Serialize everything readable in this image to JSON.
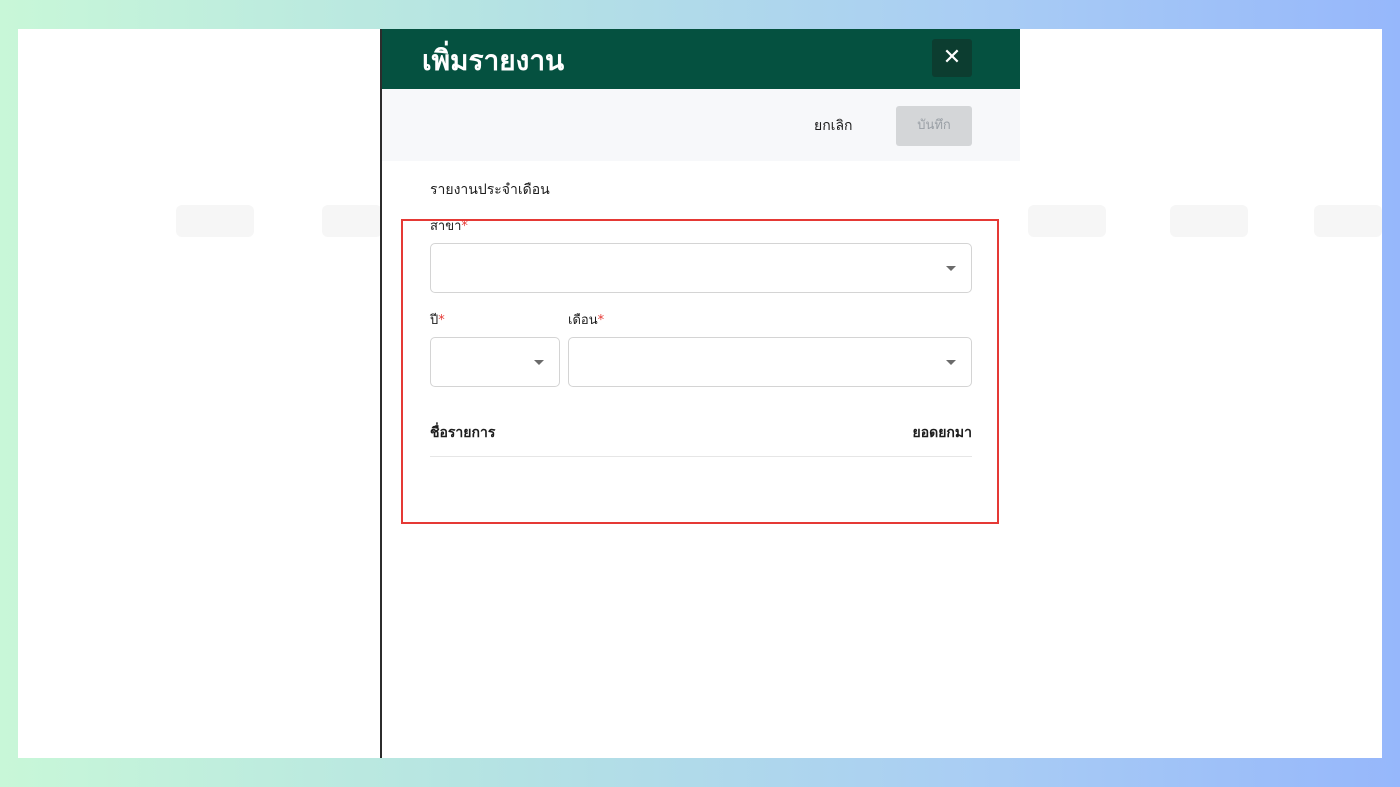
{
  "dialog": {
    "title": "เพิ่มรายงาน",
    "close_icon": "close-icon"
  },
  "actions": {
    "cancel_label": "ยกเลิก",
    "save_label": "บันทึก"
  },
  "form": {
    "section_title": "รายงานประจำเดือน",
    "branch": {
      "label": "สาขา",
      "required_mark": "*",
      "value": ""
    },
    "year": {
      "label": "ปี",
      "required_mark": "*",
      "value": ""
    },
    "month": {
      "label": "เดือน",
      "required_mark": "*",
      "value": ""
    }
  },
  "table": {
    "columns": [
      "ชื่อรายการ",
      "ยอดยกมา"
    ],
    "rows": []
  },
  "colors": {
    "header_bg": "#055140",
    "close_button_bg": "#0c3d30",
    "required": "#e53935",
    "highlight_border": "#e53935",
    "save_disabled_bg": "#d4d6d8"
  }
}
